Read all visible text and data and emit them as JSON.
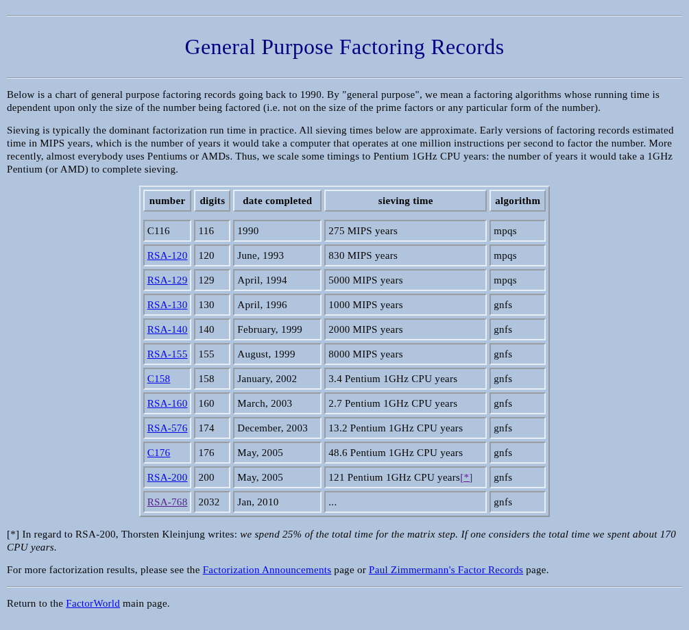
{
  "title": "General Purpose Factoring Records",
  "intro": [
    "Below is a chart of general purpose factoring records going back to 1990. By \"general purpose\", we mean a factoring algorithms whose running time is dependent upon only the size of the number being factored (i.e. not on the size of the prime factors or any particular form of the number).",
    "Sieving is typically the dominant factorization run time in practice. All sieving times below are approximate. Early versions of factoring records estimated time in MIPS years, which is the number of years it would take a computer that operates at one million instructions per second to factor the number. More recently, almost everybody uses Pentiums or AMDs. Thus, we scale some timings to Pentium 1GHz CPU years: the number of years it would take a 1GHz Pentium (or AMD) to complete sieving."
  ],
  "table": {
    "columns": [
      "number",
      "digits",
      "date completed",
      "sieving time",
      "algorithm"
    ],
    "rows": [
      {
        "number": {
          "text": "C116",
          "link": false
        },
        "digits": "116",
        "date": "1990",
        "sieving": "275 MIPS years",
        "algorithm": "mpqs"
      },
      {
        "number": {
          "text": "RSA-120",
          "link": true,
          "visited": false
        },
        "digits": "120",
        "date": "June, 1993",
        "sieving": "830 MIPS years",
        "algorithm": "mpqs"
      },
      {
        "number": {
          "text": "RSA-129",
          "link": true,
          "visited": false
        },
        "digits": "129",
        "date": "April, 1994",
        "sieving": "5000 MIPS years",
        "algorithm": "mpqs"
      },
      {
        "number": {
          "text": "RSA-130",
          "link": true,
          "visited": false
        },
        "digits": "130",
        "date": "April, 1996",
        "sieving": "1000 MIPS years",
        "algorithm": "gnfs"
      },
      {
        "number": {
          "text": "RSA-140",
          "link": true,
          "visited": false
        },
        "digits": "140",
        "date": "February, 1999",
        "sieving": "2000 MIPS years",
        "algorithm": "gnfs"
      },
      {
        "number": {
          "text": "RSA-155",
          "link": true,
          "visited": false
        },
        "digits": "155",
        "date": "August, 1999",
        "sieving": "8000 MIPS years",
        "algorithm": "gnfs"
      },
      {
        "number": {
          "text": "C158",
          "link": true,
          "visited": false
        },
        "digits": "158",
        "date": "January, 2002",
        "sieving": "3.4 Pentium 1GHz CPU years",
        "algorithm": "gnfs"
      },
      {
        "number": {
          "text": "RSA-160",
          "link": true,
          "visited": false
        },
        "digits": "160",
        "date": "March, 2003",
        "sieving": "2.7 Pentium 1GHz CPU years",
        "algorithm": "gnfs"
      },
      {
        "number": {
          "text": "RSA-576",
          "link": true,
          "visited": false
        },
        "digits": "174",
        "date": "December, 2003",
        "sieving": "13.2 Pentium 1GHz CPU years",
        "algorithm": "gnfs"
      },
      {
        "number": {
          "text": "C176",
          "link": true,
          "visited": false
        },
        "digits": "176",
        "date": "May, 2005",
        "sieving": "48.6 Pentium 1GHz CPU years",
        "algorithm": "gnfs"
      },
      {
        "number": {
          "text": "RSA-200",
          "link": true,
          "visited": false
        },
        "digits": "200",
        "date": "May, 2005",
        "sieving": "121 Pentium 1GHz CPU years",
        "note": {
          "text": "[*]",
          "visited": true
        },
        "algorithm": "gnfs"
      },
      {
        "number": {
          "text": "RSA-768",
          "link": true,
          "visited": true
        },
        "digits": "2032",
        "date": "Jan, 2010",
        "sieving": "...",
        "algorithm": "gnfs"
      }
    ]
  },
  "footnote": "[*] In regard to RSA-200, Thorsten Kleinjung writes: *we spend 25% of the total time for the matrix step. If one considers the total time we spent about 170 CPU years.*",
  "more": [
    {
      "text": "For more factorization results, please see the "
    },
    {
      "link": "Factorization Announcements",
      "visited": false
    },
    {
      "text": " page or "
    },
    {
      "link": "Paul Zimmermann's Factor Records",
      "visited": false
    },
    {
      "text": " page."
    }
  ],
  "return": [
    {
      "text": "Return to the "
    },
    {
      "link": "FactorWorld",
      "visited": false
    },
    {
      "text": " main page."
    }
  ]
}
